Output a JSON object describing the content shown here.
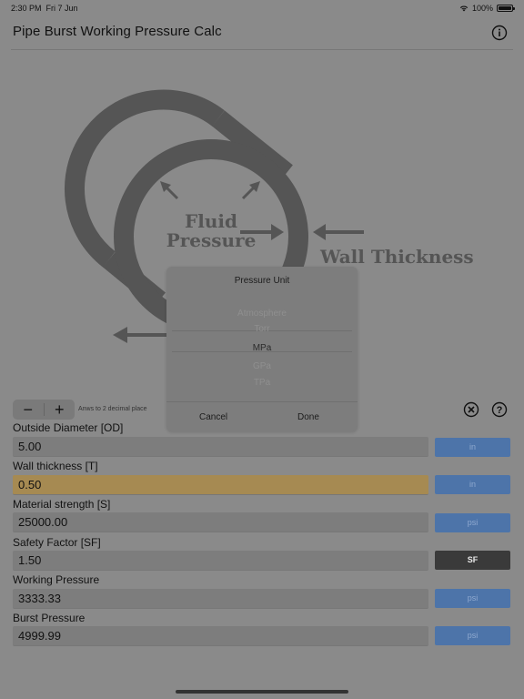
{
  "status": {
    "time": "2:30 PM",
    "date": "Fri 7 Jun",
    "battery": "100%",
    "battery_level": 1.0
  },
  "header": {
    "title": "Pipe Burst Working Pressure Calc"
  },
  "diagram": {
    "label_fluid": "Fluid",
    "label_pressure": "Pressure",
    "label_wall": "Wall Thickness"
  },
  "toolbar": {
    "minus": "−",
    "plus": "+",
    "decimals": "Anws to 2 decimal place"
  },
  "fields": [
    {
      "label": "Outside Diameter [OD]",
      "value": "5.00",
      "unit": "in"
    },
    {
      "label": "Wall thickness [T]",
      "value": "0.50",
      "unit": "in"
    },
    {
      "label": "Material strength [S]",
      "value": "25000.00",
      "unit": "psi"
    },
    {
      "label": "Safety Factor [SF]",
      "value": "1.50",
      "unit": "SF"
    },
    {
      "label": "Working Pressure",
      "value": "3333.33",
      "unit": "psi"
    },
    {
      "label": "Burst Pressure",
      "value": "4999.99",
      "unit": "psi"
    }
  ],
  "picker": {
    "title": "Pressure Unit",
    "options": [
      "Atmosphere",
      "Torr",
      "MPa",
      "GPa",
      "TPa"
    ],
    "selected": "MPa",
    "cancel": "Cancel",
    "done": "Done"
  },
  "colors": {
    "background": "#8a8a8a",
    "unit_button": "#4d74a9",
    "active_field": "#a68a52",
    "sf_button": "#3a3a3a"
  }
}
